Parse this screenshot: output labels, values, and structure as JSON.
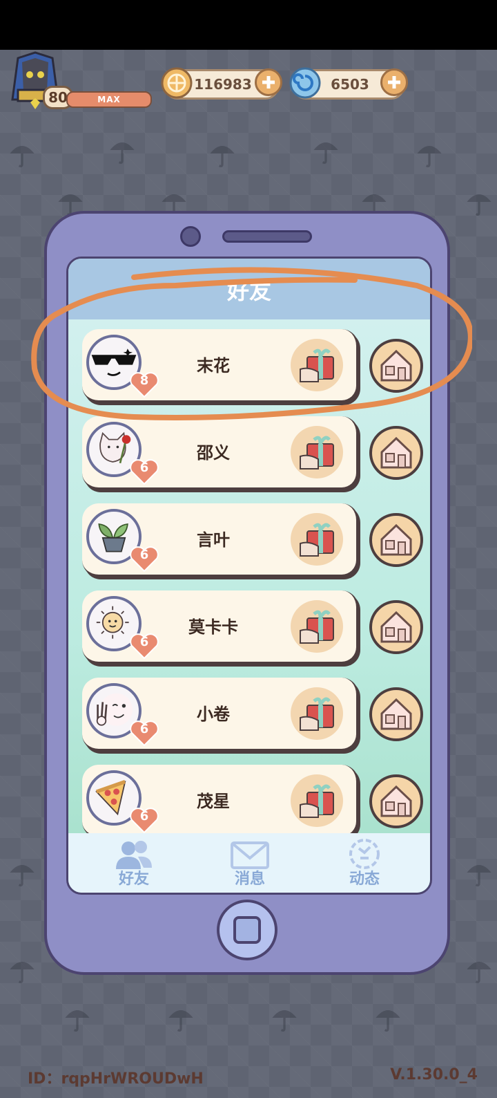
{
  "hud": {
    "level": "80",
    "xp_label": "MAX",
    "coins": "116983",
    "gems": "6503"
  },
  "panel": {
    "title": "好友"
  },
  "friends": [
    {
      "name": "末花",
      "hearts": "8",
      "avatar": "sunglasses-face"
    },
    {
      "name": "邵义",
      "hearts": "6",
      "avatar": "cat-with-rose"
    },
    {
      "name": "言叶",
      "hearts": "6",
      "avatar": "potted-plant"
    },
    {
      "name": "莫卡卡",
      "hearts": "6",
      "avatar": "sun-face"
    },
    {
      "name": "小卷",
      "hearts": "6",
      "avatar": "winking-face"
    },
    {
      "name": "茂星",
      "hearts": "6",
      "avatar": "pizza-slice"
    }
  ],
  "tabs": [
    {
      "label": "好友",
      "icon": "friends-icon"
    },
    {
      "label": "消息",
      "icon": "mail-icon"
    },
    {
      "label": "动态",
      "icon": "feed-icon"
    }
  ],
  "footer": {
    "id_text": "ID：rqpHrWROUDwH",
    "version": "V.1.30.0_4"
  },
  "colors": {
    "phone_body": "#8f8fc6",
    "header": "#a8c7e3",
    "heart": "#e98a70",
    "annotation": "#e58c50"
  }
}
